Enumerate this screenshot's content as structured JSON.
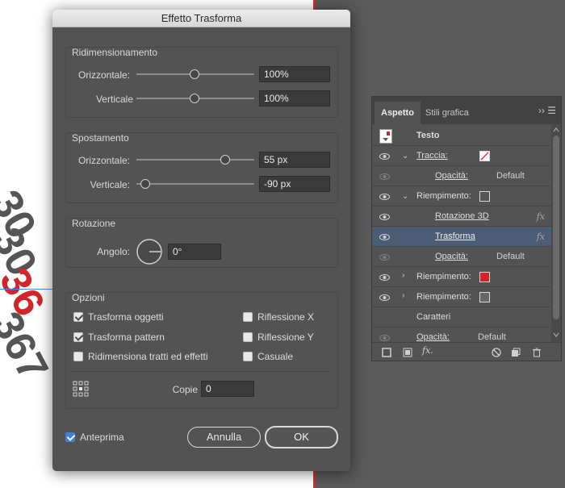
{
  "dialog": {
    "title": "Effetto Trasforma",
    "scale": {
      "title": "Ridimensionamento",
      "h_label": "Orizzontale:",
      "h_value": "100%",
      "v_label": "Verticale",
      "v_value": "100%"
    },
    "move": {
      "title": "Spostamento",
      "h_label": "Orizzontale:",
      "h_value": "55 px",
      "v_label": "Verticale:",
      "v_value": "-90 px"
    },
    "rotate": {
      "title": "Rotazione",
      "angle_label": "Angolo:",
      "angle_value": "0°"
    },
    "options": {
      "title": "Opzioni",
      "transform_objects": "Trasforma oggetti",
      "transform_patterns": "Trasforma pattern",
      "scale_strokes": "Ridimensiona tratti ed effetti",
      "reflect_x": "Riflessione X",
      "reflect_y": "Riflessione Y",
      "random": "Casuale",
      "copies_label": "Copie",
      "copies_value": "0"
    },
    "preview_label": "Anteprima",
    "cancel_label": "Annulla",
    "ok_label": "OK"
  },
  "panel": {
    "tab_appearance": "Aspetto",
    "tab_graphic_styles": "Stili grafica",
    "menu_glyphs": "›› ☰",
    "rows": {
      "text": "Testo",
      "stroke": "Traccia:",
      "stroke_opacity": "Opacità:",
      "stroke_opacity_value": "Default",
      "fill": "Riempimento:",
      "rotate3d": "Rotazione 3D",
      "transform": "Trasforma",
      "fill_opacity": "Opacità:",
      "fill_opacity_value": "Default",
      "fill2": "Riempimento:",
      "fill3": "Riempimento:",
      "characters": "Caratteri",
      "opacity": "Opacità:",
      "opacity_value": "Default"
    },
    "fx_glyph": "fx",
    "footer_fx": "fx."
  },
  "colors": {
    "red_accent": "#d4232a",
    "selection": "#4b5c74",
    "checkbox_blue": "#3d82d9"
  }
}
